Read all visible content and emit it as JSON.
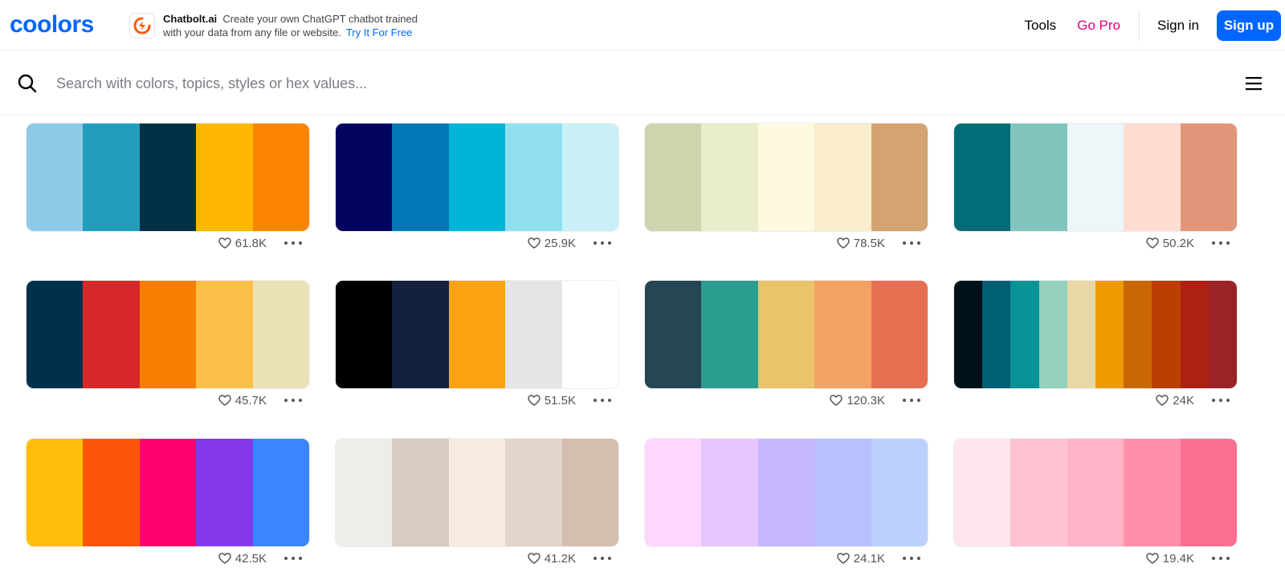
{
  "header": {
    "logo_text": "coolors",
    "ad": {
      "brand": "Chatbolt.ai",
      "line1": "Create your own ChatGPT chatbot trained",
      "line2": "with your data from any file or website.",
      "cta": "Try It For Free"
    },
    "nav": {
      "tools": "Tools",
      "go_pro": "Go Pro",
      "sign_in": "Sign in",
      "sign_up": "Sign up"
    }
  },
  "search": {
    "placeholder": "Search with colors, topics, styles or hex values...",
    "value": ""
  },
  "colors": {
    "accent": "#0066ff",
    "pro": "#e6007e",
    "logo": "#0066ff"
  },
  "palettes": [
    {
      "colors": [
        "#8ecae6",
        "#219ebc",
        "#023047",
        "#ffb703",
        "#fb8500"
      ],
      "likes": "61.8K"
    },
    {
      "colors": [
        "#03045e",
        "#0077b6",
        "#00b4d8",
        "#90e0ef",
        "#caf0f8"
      ],
      "likes": "25.9K"
    },
    {
      "colors": [
        "#ccd5ae",
        "#e9edc9",
        "#fefae0",
        "#faedcd",
        "#d4a373"
      ],
      "likes": "78.5K"
    },
    {
      "colors": [
        "#006d77",
        "#83c5be",
        "#edf6f9",
        "#ffddd2",
        "#e29578"
      ],
      "likes": "50.2K"
    },
    {
      "colors": [
        "#003049",
        "#d62828",
        "#f77f00",
        "#fcbf49",
        "#eae2b7"
      ],
      "likes": "45.7K"
    },
    {
      "colors": [
        "#000000",
        "#14213d",
        "#fca311",
        "#e5e5e5",
        "#ffffff"
      ],
      "likes": "51.5K"
    },
    {
      "colors": [
        "#264653",
        "#2a9d8f",
        "#e9c46a",
        "#f4a261",
        "#e76f51"
      ],
      "likes": "120.3K"
    },
    {
      "colors": [
        "#001219",
        "#005f73",
        "#0a9396",
        "#94d2bd",
        "#e9d8a6",
        "#ee9b00",
        "#ca6702",
        "#bb3e03",
        "#ae2012",
        "#9b2226"
      ],
      "likes": "24K"
    },
    {
      "colors": [
        "#ffbe0b",
        "#fb5607",
        "#ff006e",
        "#8338ec",
        "#3a86ff"
      ],
      "likes": "42.5K"
    },
    {
      "colors": [
        "#edede9",
        "#d6ccc2",
        "#f5ebe0",
        "#e3d5ca",
        "#d5bdaf"
      ],
      "likes": "41.2K"
    },
    {
      "colors": [
        "#ffd6ff",
        "#e7c6ff",
        "#c8b6ff",
        "#b8c0ff",
        "#bbd0ff"
      ],
      "likes": "24.1K"
    },
    {
      "colors": [
        "#ffe5ec",
        "#ffc2d1",
        "#ffb3c6",
        "#ff8fab",
        "#fb6f92"
      ],
      "likes": "19.4K"
    }
  ]
}
